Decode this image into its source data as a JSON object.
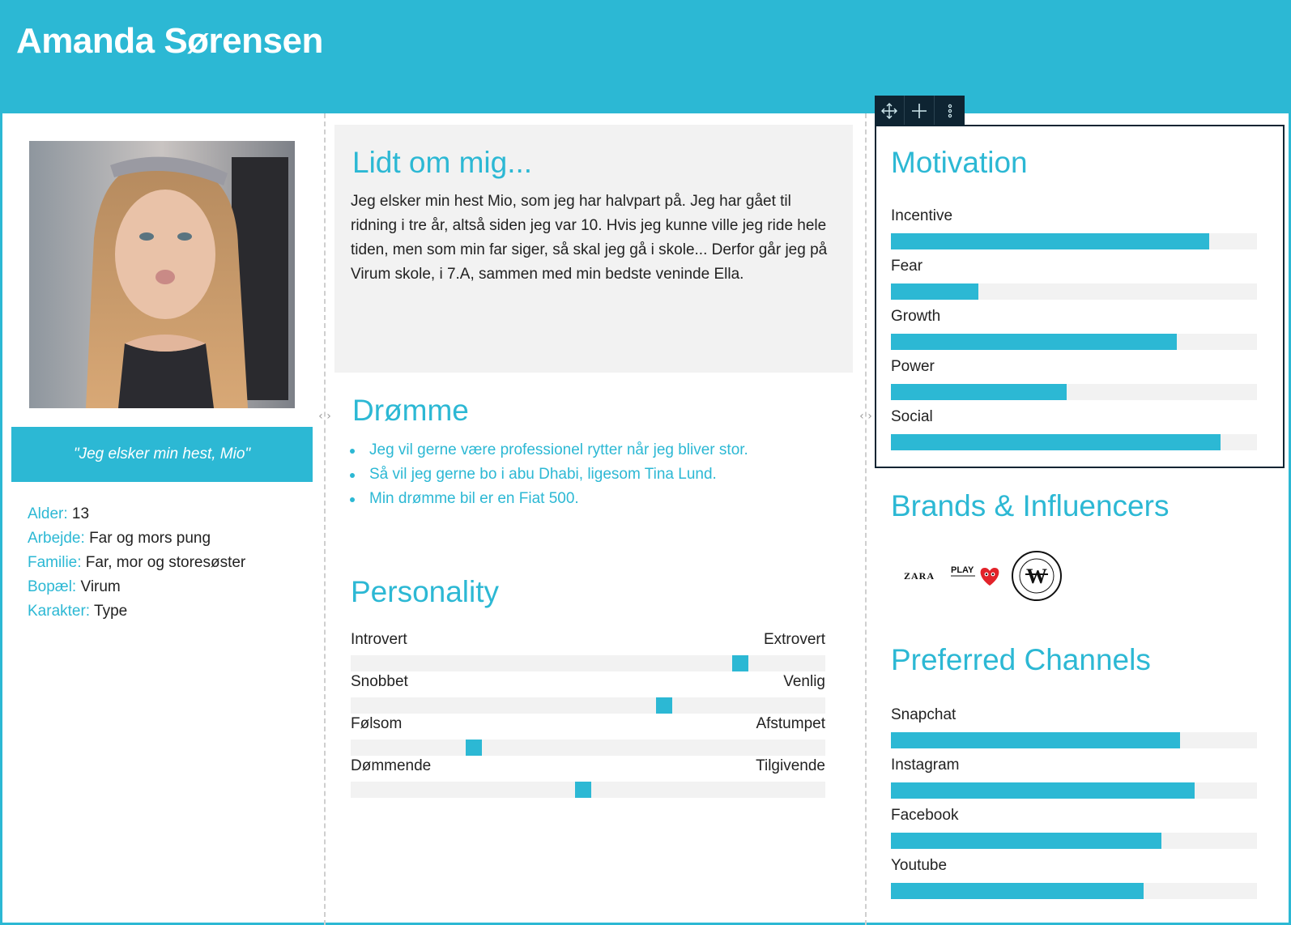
{
  "header": {
    "name": "Amanda Sørensen"
  },
  "profile": {
    "quote": "\"Jeg elsker min hest, Mio\"",
    "facts": [
      {
        "key": "Alder:",
        "value": "13"
      },
      {
        "key": "Arbejde:",
        "value": "Far og mors pung"
      },
      {
        "key": "Familie:",
        "value": "Far, mor og storesøster"
      },
      {
        "key": "Bopæl:",
        "value": "Virum"
      },
      {
        "key": "Karakter:",
        "value": "Type"
      }
    ]
  },
  "about": {
    "title": "Lidt om mig...",
    "text": "Jeg elsker min hest Mio, som jeg har halvpart på. Jeg har gået til ridning i tre år, altså siden jeg var 10. Hvis jeg kunne ville jeg ride hele tiden, men som min far siger, så skal jeg gå i skole... Derfor går jeg på Virum skole, i 7.A, sammen med min bedste veninde Ella."
  },
  "dreams": {
    "title": "Drømme",
    "items": [
      "Jeg vil gerne være professionel rytter når jeg bliver stor.",
      "Så vil jeg gerne bo i abu Dhabi, ligesom Tina Lund.",
      "Min drømme bil er en Fiat 500."
    ]
  },
  "personality": {
    "title": "Personality",
    "traits": [
      {
        "left": "Introvert",
        "right": "Extrovert",
        "value": 0.82
      },
      {
        "left": "Snobbet",
        "right": "Venlig",
        "value": 0.66
      },
      {
        "left": "Følsom",
        "right": "Afstumpet",
        "value": 0.26
      },
      {
        "left": "Dømmende",
        "right": "Tilgivende",
        "value": 0.49
      }
    ]
  },
  "motivation": {
    "title": "Motivation",
    "items": [
      {
        "label": "Incentive",
        "value": 0.87
      },
      {
        "label": "Fear",
        "value": 0.24
      },
      {
        "label": "Growth",
        "value": 0.78
      },
      {
        "label": "Power",
        "value": 0.48
      },
      {
        "label": "Social",
        "value": 0.9
      }
    ]
  },
  "brands": {
    "title": "Brands & Influencers",
    "logos": [
      {
        "name": "zara-logo",
        "text": "ZARA"
      },
      {
        "name": "play-cdg-logo",
        "text": "PLAY"
      },
      {
        "name": "wood-wood-logo",
        "text": "W"
      }
    ]
  },
  "channels": {
    "title": "Preferred Channels",
    "items": [
      {
        "label": "Snapchat",
        "value": 0.79
      },
      {
        "label": "Instagram",
        "value": 0.83
      },
      {
        "label": "Facebook",
        "value": 0.74
      },
      {
        "label": "Youtube",
        "value": 0.69
      }
    ]
  },
  "colors": {
    "accent": "#2cb8d4",
    "panel": "#f2f2f2",
    "toolbar": "#0e2432"
  },
  "toolbar_icons": [
    "move-icon",
    "plus-icon",
    "more-vertical-icon"
  ]
}
